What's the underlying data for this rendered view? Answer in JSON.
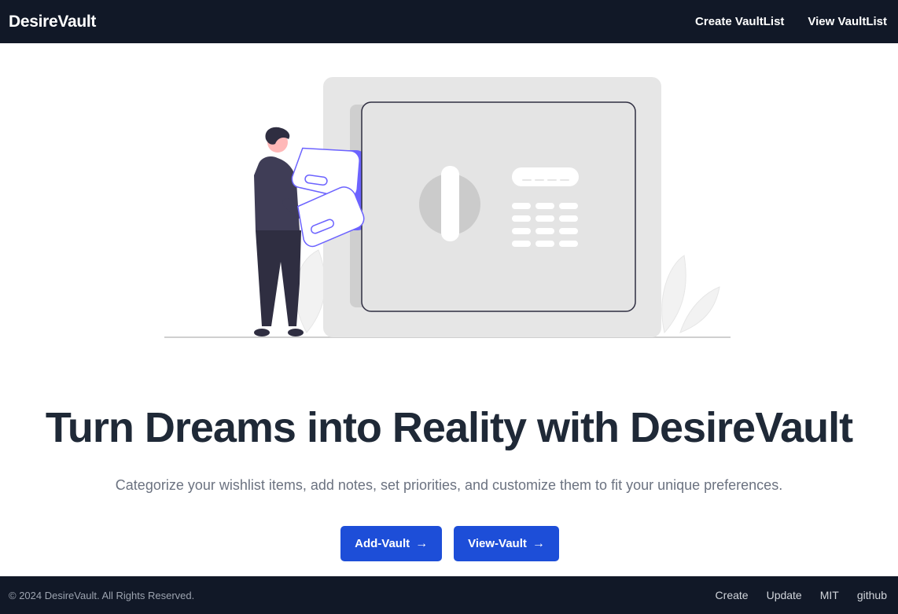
{
  "navbar": {
    "brand": "DesireVault",
    "links": [
      "Create VaultList",
      "View VaultList"
    ]
  },
  "hero": {
    "illustration": "person-storing-cards-in-safe-illustration",
    "headline": "Turn Dreams into Reality with DesireVault",
    "subtitle": "Categorize your wishlist items, add notes, set priorities, and customize them to fit your unique preferences.",
    "buttons": [
      {
        "label": "Add-Vault",
        "icon": "arrow-right-icon"
      },
      {
        "label": "View-Vault",
        "icon": "arrow-right-icon"
      }
    ]
  },
  "footer": {
    "copyright": "© 2024 DesireVault. All Rights Reserved.",
    "links": [
      "Create",
      "Update",
      "MIT",
      "github"
    ]
  },
  "colors": {
    "navbar_bg": "#111827",
    "primary_button": "#1d4ed8",
    "headline": "#1f2937",
    "subtitle": "#6b7280",
    "illustration_accent": "#6c63ff"
  }
}
